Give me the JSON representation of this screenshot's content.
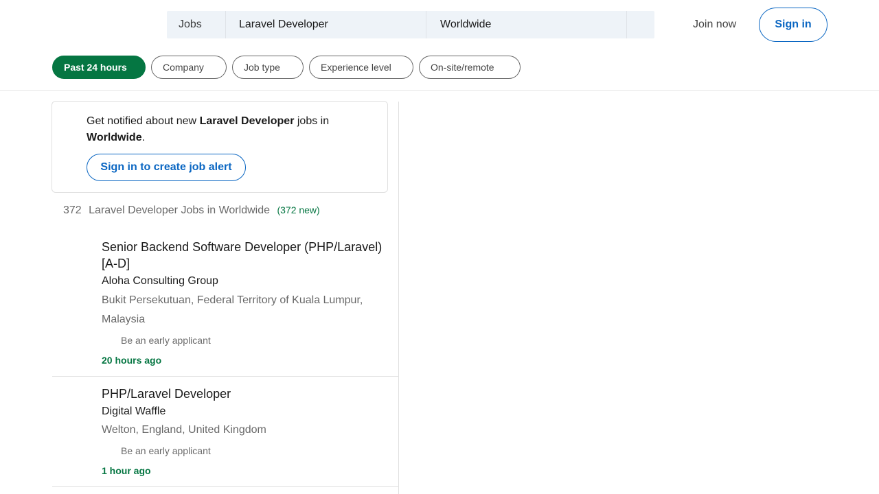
{
  "search": {
    "category": "Jobs",
    "keywords": "Laravel Developer",
    "location": "Worldwide"
  },
  "header": {
    "join_label": "Join now",
    "signin_label": "Sign in"
  },
  "filters": [
    {
      "label": "Past 24 hours",
      "active": true
    },
    {
      "label": "Company",
      "active": false
    },
    {
      "label": "Job type",
      "active": false
    },
    {
      "label": "Experience level",
      "active": false
    },
    {
      "label": "On-site/remote",
      "active": false
    }
  ],
  "alert": {
    "prefix": "Get notified about new ",
    "keyword": "Laravel Developer",
    "middle": " jobs in ",
    "location": "Worldwide",
    "suffix": ".",
    "cta_label": "Sign in to create job alert"
  },
  "results": {
    "count": "372",
    "label": "Laravel Developer Jobs in Worldwide",
    "new_label": "(372 new)"
  },
  "jobs": [
    {
      "title": "Senior Backend Software Developer (PHP/Laravel) [A-D]",
      "company": "Aloha Consulting Group",
      "location": "Bukit Persekutuan, Federal Territory of Kuala Lumpur, Malaysia",
      "badge": "Be an early applicant",
      "posted": "20 hours ago"
    },
    {
      "title": "PHP/Laravel Developer",
      "company": "Digital Waffle",
      "location": "Welton, England, United Kingdom",
      "badge": "Be an early applicant",
      "posted": "1 hour ago"
    }
  ],
  "colors": {
    "accent_blue": "#0a66c2",
    "accent_green": "#057642",
    "search_bg": "#eef3f8"
  }
}
